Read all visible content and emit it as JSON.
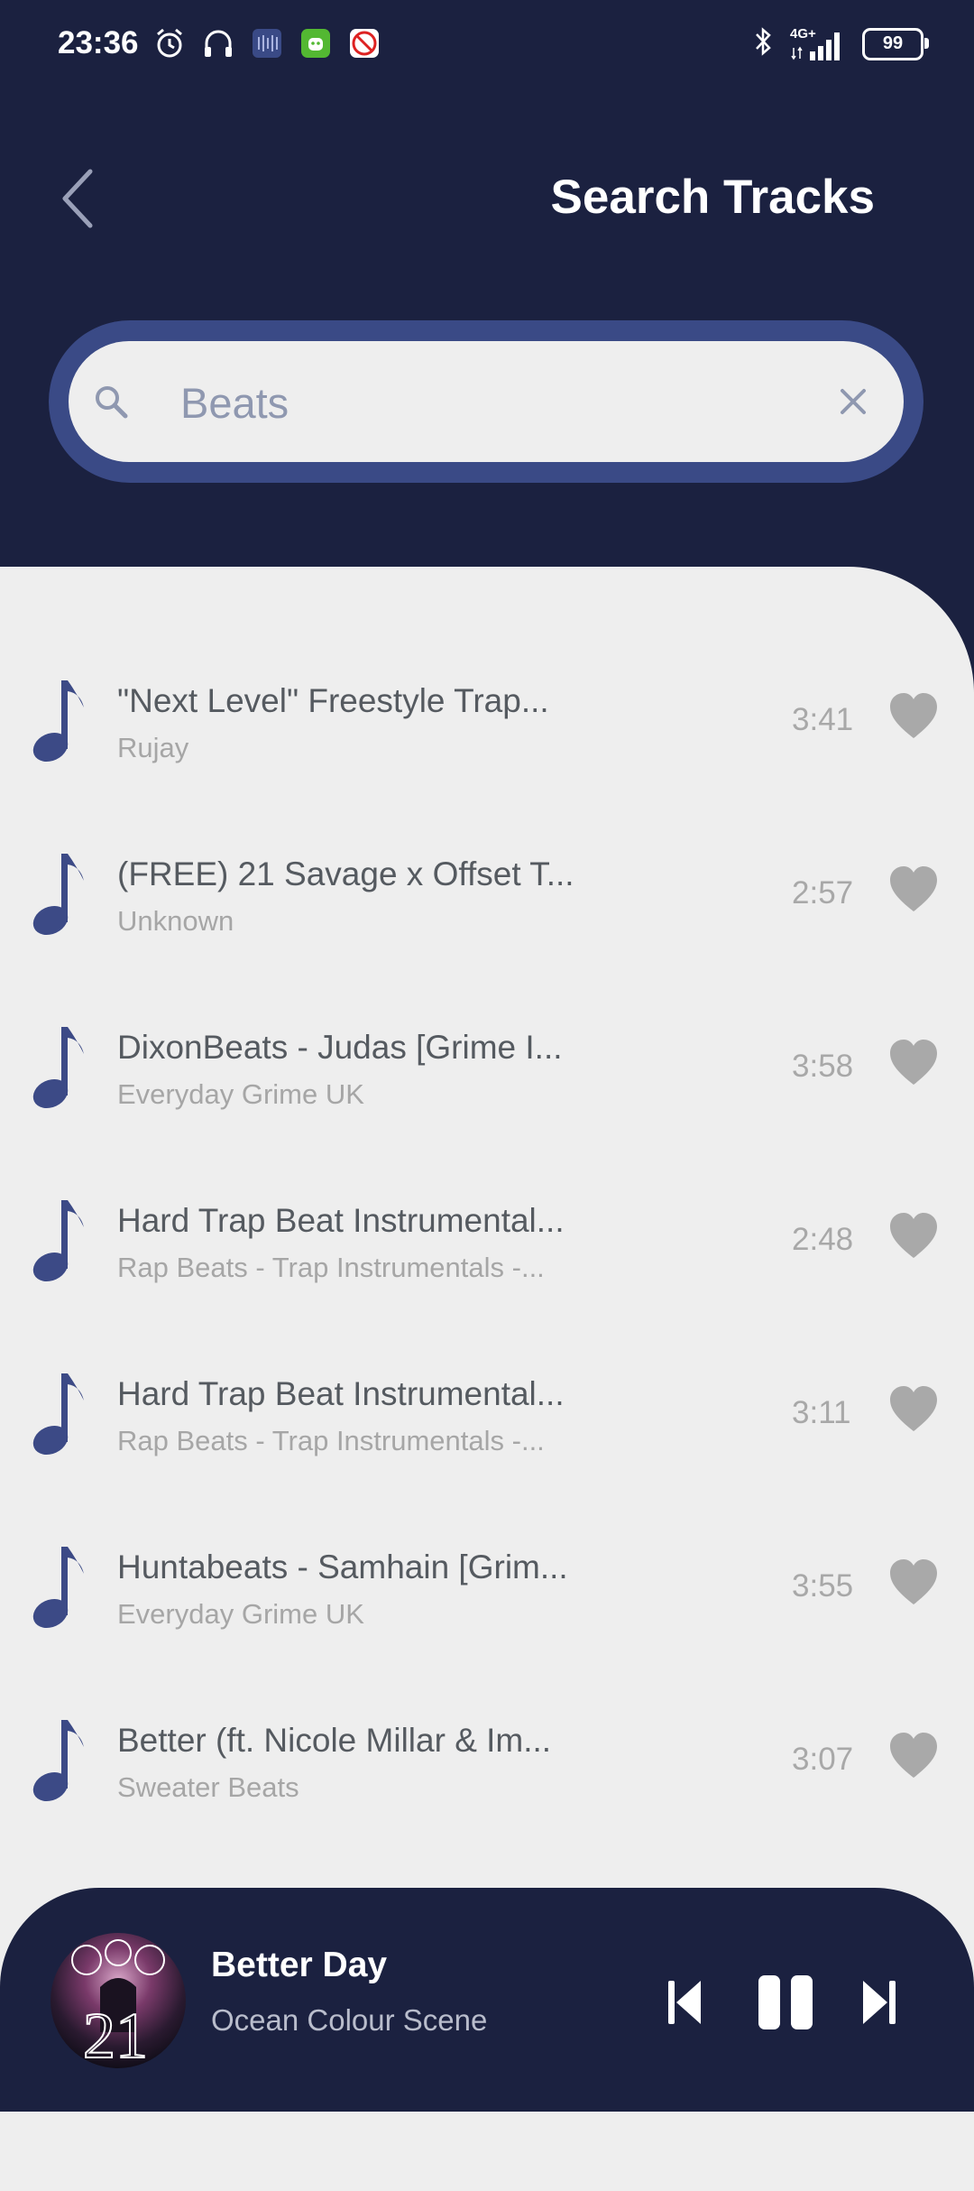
{
  "status_bar": {
    "time": "23:36",
    "battery": "99",
    "network": "4G+",
    "icons_left": [
      "alarm-icon",
      "headphones-icon",
      "app-icon",
      "android-app-icon",
      "no-ads-icon"
    ],
    "icons_right": [
      "bluetooth-icon",
      "signal-icon",
      "battery-icon"
    ]
  },
  "header": {
    "title": "Search Tracks",
    "back_icon": "chevron-left-icon"
  },
  "search": {
    "value": "Beats",
    "icon": "search-icon",
    "clear_icon": "close-icon"
  },
  "tracks": [
    {
      "title": "\"Next Level\"   Freestyle Trap...",
      "artist": "Rujay",
      "duration": "3:41"
    },
    {
      "title": "(FREE) 21 Savage x Offset T...",
      "artist": "Unknown",
      "duration": "2:57"
    },
    {
      "title": "DixonBeats - Judas [Grime I...",
      "artist": "Everyday Grime UK",
      "duration": "3:58"
    },
    {
      "title": "Hard Trap Beat Instrumental...",
      "artist": "Rap Beats - Trap Instrumentals -...",
      "duration": "2:48"
    },
    {
      "title": "Hard Trap Beat Instrumental...",
      "artist": "Rap Beats - Trap Instrumentals -...",
      "duration": "3:11"
    },
    {
      "title": "Huntabeats - Samhain [Grim...",
      "artist": "Everyday Grime UK",
      "duration": "3:55"
    },
    {
      "title": "Better (ft. Nicole Millar & Im...",
      "artist": "Sweater Beats",
      "duration": "3:07"
    }
  ],
  "now_playing": {
    "title": "Better Day",
    "artist": "Ocean Colour Scene",
    "album_art_text": "21",
    "controls": [
      "previous-icon",
      "pause-icon",
      "next-icon"
    ]
  },
  "colors": {
    "header_bg": "#1b2140",
    "accent": "#3a4a86",
    "list_bg": "#eeeeee",
    "note": "#3c4a86",
    "heart": "#a9a9a9"
  }
}
